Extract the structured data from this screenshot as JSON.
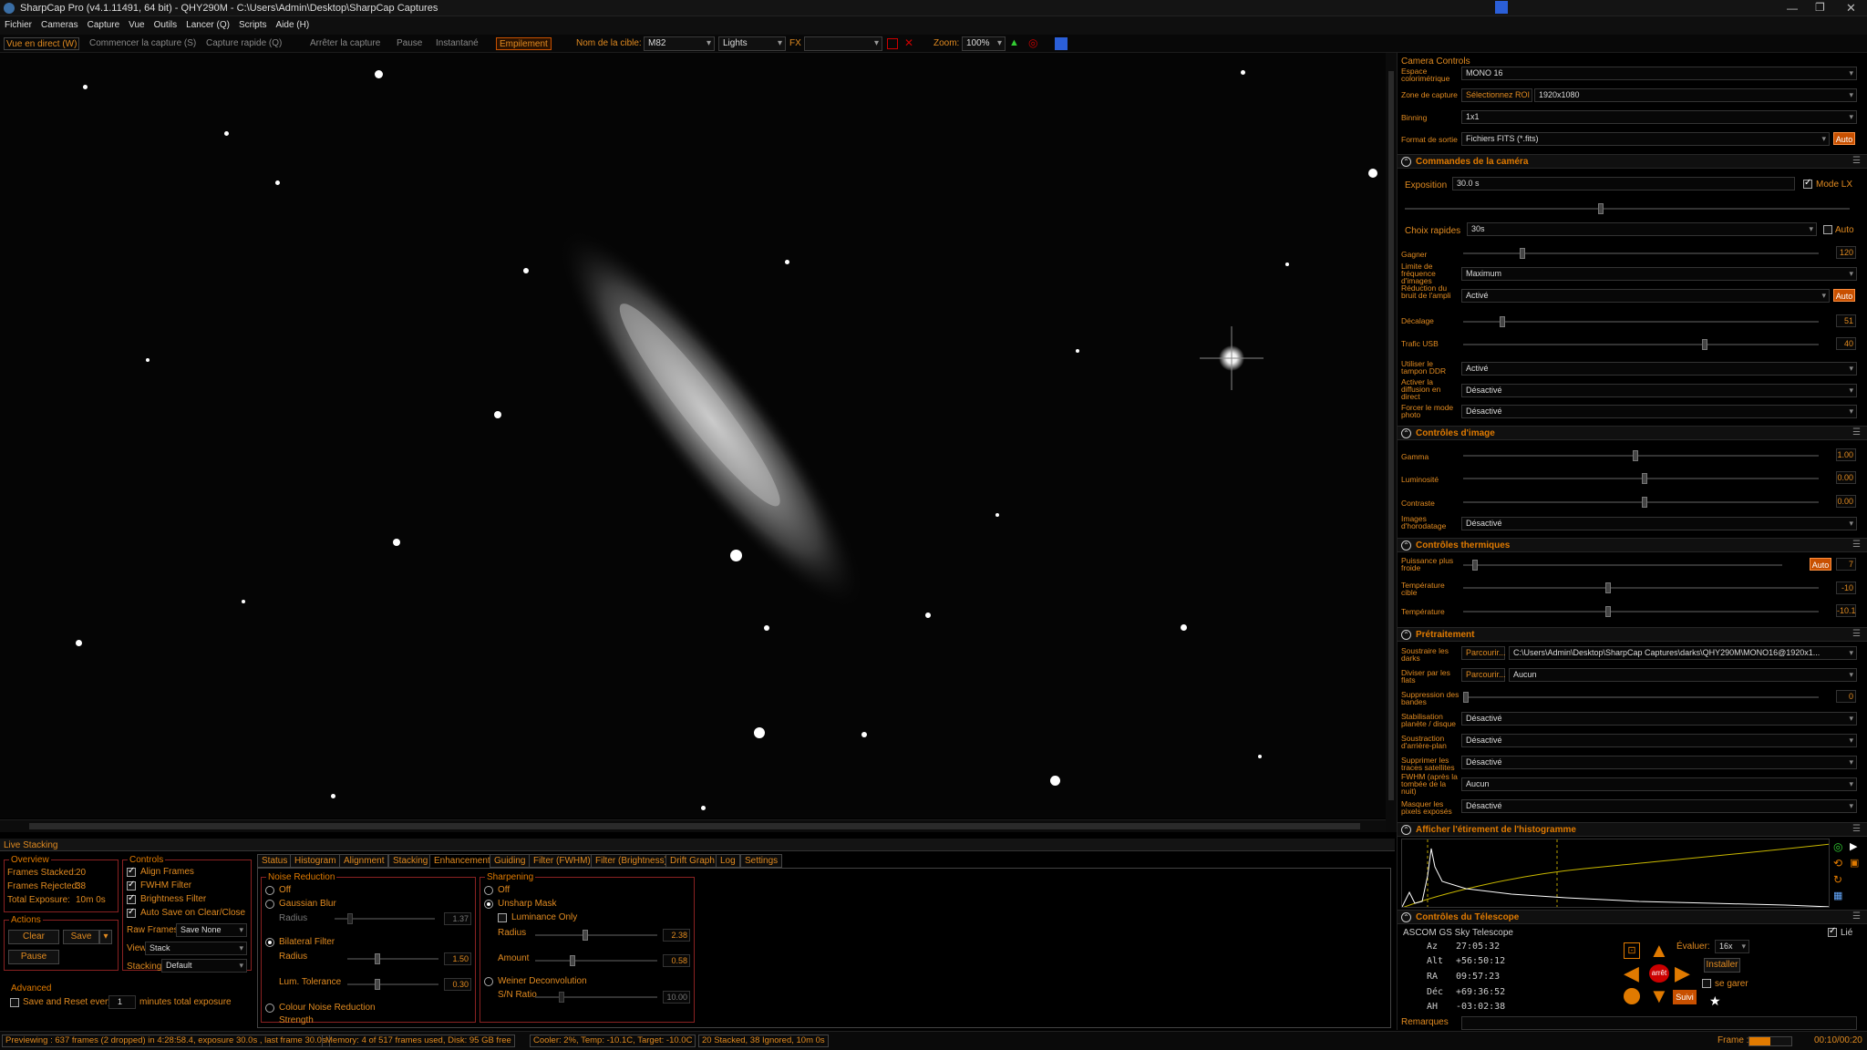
{
  "window": {
    "title": "SharpCap Pro (v4.1.11491, 64 bit) - QHY290M - C:\\Users\\Admin\\Desktop\\SharpCap Captures"
  },
  "menu": [
    "Fichier",
    "Cameras",
    "Capture",
    "Vue",
    "Outils",
    "Lancer (Q)",
    "Scripts",
    "Aide (H)"
  ],
  "toolbar": {
    "live": "Vue en direct (W)",
    "start": "Commencer la capture (S)",
    "quick": "Capture rapide (Q)",
    "stop": "Arrêter la capture",
    "pause": "Pause",
    "snapshot": "Instantané",
    "stack": "Empilement",
    "target_label": "Nom de la cible:",
    "target": "M82",
    "frame_type": "Lights",
    "fx": "FX",
    "zoom_label": "Zoom:",
    "zoom": "100%"
  },
  "camera_controls": {
    "title": "Camera Controls",
    "colorspace_label": "Espace colorimétrique",
    "colorspace": "MONO 16",
    "capture_area_label": "Zone de capture",
    "roi_button": "Sélectionnez ROI",
    "capture_area": "1920x1080",
    "binning_label": "Binning",
    "binning": "1x1",
    "output_label": "Format de sortie",
    "output": "Fichiers FITS (*.fits)",
    "auto": "Auto"
  },
  "cam_cmd": {
    "title": "Commandes de la caméra",
    "exposure_label": "Exposition",
    "exposure": "30.0 s",
    "lx_label": "Mode LX",
    "quick_label": "Choix rapides",
    "quick": "30s",
    "auto_label": "Auto",
    "gain_label": "Gagner",
    "gain": "120",
    "freq_label": "Limite de fréquence d'images",
    "freq": "Maximum",
    "amp_label": "Réduction du bruit de l'ampli",
    "amp": "Activé",
    "offset_label": "Décalage",
    "offset": "51",
    "usb_label": "Trafic USB",
    "usb": "40",
    "ddr_label": "Utiliser le tampon DDR",
    "ddr": "Activé",
    "stream_label": "Activer la diffusion en direct",
    "stream": "Désactivé",
    "still_label": "Forcer le mode photo",
    "still": "Désactivé"
  },
  "image_ctrl": {
    "title": "Contrôles d'image",
    "gamma_label": "Gamma",
    "gamma": "1.00",
    "lum_label": "Luminosité",
    "lum": "0.00",
    "contrast_label": "Contraste",
    "contrast": "0.00",
    "ts_label": "Images d'horodatage",
    "ts": "Désactivé"
  },
  "thermal": {
    "title": "Contrôles thermiques",
    "power_label": "Puissance plus froide",
    "power": "7",
    "target_label": "Température cible",
    "target": "-10",
    "temp_label": "Température",
    "temp": "-10.1",
    "auto": "Auto"
  },
  "preproc": {
    "title": "Prétraitement",
    "dark_label": "Soustraire les darks",
    "browse": "Parcourir...",
    "dark": "C:\\Users\\Admin\\Desktop\\SharpCap Captures\\darks\\QHY290M\\MONO16@1920x1...",
    "flat_label": "Diviser par les flats",
    "flat": "Aucun",
    "band_label": "Suppression des bandes",
    "band": "0",
    "stab_label": "Stabilisation planète / disque",
    "stab": "Désactivé",
    "bg_label": "Soustraction d'arrière-plan",
    "bg": "Désactivé",
    "sat_label": "Supprimer les traces satellites",
    "sat": "Désactivé",
    "fwhm_label": "FWHM (après la tombée de la nuit)",
    "fwhm": "Aucun",
    "mask_label": "Masquer les pixels exposés",
    "mask": "Désactivé"
  },
  "histogram": {
    "title": "Afficher l'étirement de l'histogramme"
  },
  "telescope": {
    "title": "Contrôles du Télescope",
    "mount": "ASCOM GS Sky Telescope",
    "linked": "Lié",
    "az_label": "Az",
    "az": "27:05:32",
    "alt_label": "Alt",
    "alt": "+56:50:12",
    "ra_label": "RA",
    "ra": "09:57:23",
    "dec_label": "Déc",
    "dec": "+69:36:52",
    "ah_label": "AH",
    "ah": "-03:02:38",
    "rate_label": "Évaluer:",
    "rate": "16x",
    "install": "Installer",
    "park": "se garer",
    "track": "Suivi",
    "stop": "arrêt"
  },
  "remarks": "Remarques",
  "live_stacking": {
    "title": "Live Stacking",
    "overview": {
      "title": "Overview",
      "frames_stacked_label": "Frames Stacked:",
      "frames_stacked": "20",
      "frames_rejected_label": "Frames Rejected:",
      "frames_rejected": "38",
      "total_exposure_label": "Total Exposure:",
      "total_exposure": "10m 0s"
    },
    "actions": {
      "title": "Actions",
      "clear": "Clear",
      "save": "Save",
      "pause": "Pause"
    },
    "controls": {
      "title": "Controls",
      "align": "Align Frames",
      "fwhm": "FWHM Filter",
      "brightness": "Brightness Filter",
      "autosave": "Auto Save on Clear/Close",
      "raw_label": "Raw Frames",
      "raw": "Save None",
      "view_label": "View",
      "view": "Stack",
      "stacking_label": "Stacking",
      "stacking": "Default"
    },
    "advanced": {
      "title": "Advanced",
      "save_reset": "Save and Reset every",
      "minutes": "1",
      "minutes_suffix": "minutes total exposure"
    },
    "tabs": [
      "Status",
      "Histogram",
      "Alignment",
      "Stacking",
      "Enhancement",
      "Guiding",
      "Filter (FWHM)",
      "Filter (Brightness)",
      "Drift Graph",
      "Log",
      "Settings"
    ],
    "noise": {
      "title": "Noise Reduction",
      "off": "Off",
      "gauss": "Gaussian Blur",
      "radius_label": "Radius",
      "gauss_radius": "1.37",
      "bilateral": "Bilateral Filter",
      "bil_radius": "1.50",
      "lum_tol_label": "Lum. Tolerance",
      "lum_tol": "0.30",
      "colour": "Colour Noise Reduction",
      "strength_label": "Strength"
    },
    "sharp": {
      "title": "Sharpening",
      "off": "Off",
      "unsharp": "Unsharp Mask",
      "lum_only": "Luminance Only",
      "radius_label": "Radius",
      "radius": "2.38",
      "amount_label": "Amount",
      "amount": "0.58",
      "weiner": "Weiner Deconvolution",
      "sn_label": "S/N Ratio",
      "sn": "10.00"
    }
  },
  "status": {
    "preview": "Previewing : 637 frames (2 dropped) in 4:28:58.4, exposure 30.0s , last frame 30.0s",
    "memory": "Memory: 4 of 517 frames used, Disk: 95 GB free",
    "cooler": "Cooler: 2%, Temp: -10.1C, Target: -10.0C",
    "stack": "20 Stacked, 38 Ignored, 10m 0s",
    "frame_label": "Frame :",
    "frame_time": "00:10/00:20",
    "frame_progress": 0.5
  },
  "colors": {
    "accent": "#e07a00",
    "border": "#8a2222"
  }
}
